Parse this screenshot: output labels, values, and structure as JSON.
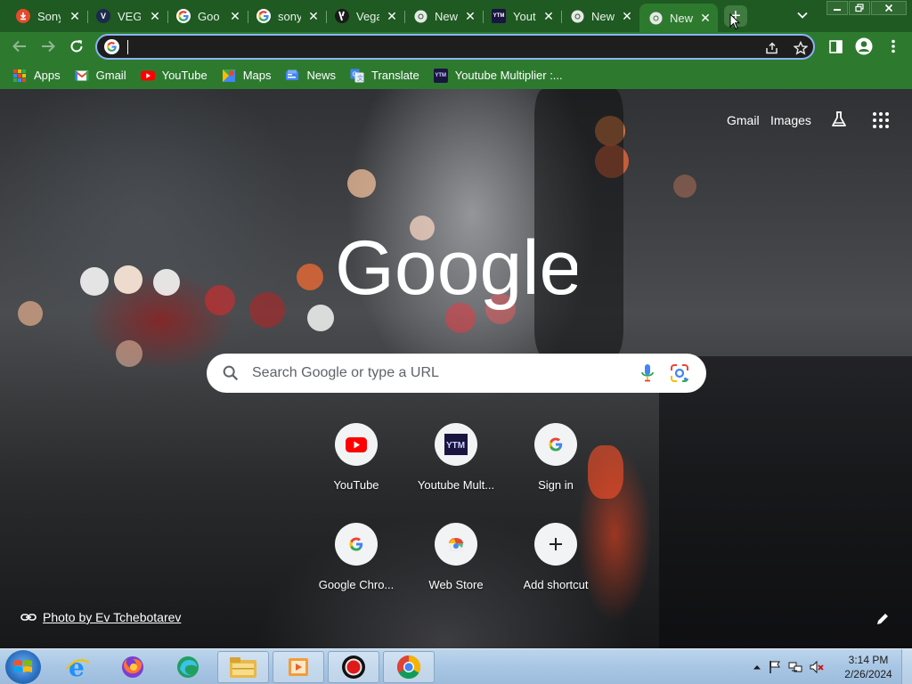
{
  "browser": {
    "tabs": [
      {
        "title": "Sony",
        "favicon": "sony-download-icon",
        "close": "✕"
      },
      {
        "title": "VEGA",
        "favicon": "vegas-v-icon",
        "close": "✕"
      },
      {
        "title": "Goo",
        "favicon": "google-g-icon",
        "close": "✕"
      },
      {
        "title": "sony",
        "favicon": "google-g-icon",
        "close": "✕"
      },
      {
        "title": "Vega",
        "favicon": "vegas-slash-icon",
        "close": "✕"
      },
      {
        "title": "New",
        "favicon": "chrome-icon",
        "close": "✕"
      },
      {
        "title": "Yout",
        "favicon": "ytm-icon",
        "close": "✕"
      },
      {
        "title": "New",
        "favicon": "chrome-icon",
        "close": "✕"
      },
      {
        "title": "New",
        "favicon": "chrome-icon",
        "close": "✕",
        "active": true
      }
    ],
    "new_tab_symbol": "+",
    "tabs_menu_symbol": "⌄",
    "omnibox": {
      "value": "",
      "placeholder": ""
    },
    "bookmarks": [
      {
        "label": "Apps",
        "icon": "apps-grid-icon"
      },
      {
        "label": "Gmail",
        "icon": "gmail-icon"
      },
      {
        "label": "YouTube",
        "icon": "youtube-icon"
      },
      {
        "label": "Maps",
        "icon": "maps-icon"
      },
      {
        "label": "News",
        "icon": "news-icon"
      },
      {
        "label": "Translate",
        "icon": "translate-icon"
      },
      {
        "label": "Youtube Multiplier :...",
        "icon": "ytm-icon"
      }
    ]
  },
  "ntp": {
    "gmail_link": "Gmail",
    "images_link": "Images",
    "search_placeholder": "Search Google or type a URL",
    "logo_text": "Google",
    "shortcuts": [
      {
        "label": "YouTube",
        "icon": "youtube-icon"
      },
      {
        "label": "Youtube Mult...",
        "icon": "ytm-icon"
      },
      {
        "label": "Sign in",
        "icon": "google-g-icon"
      },
      {
        "label": "Google Chro...",
        "icon": "google-g-icon"
      },
      {
        "label": "Web Store",
        "icon": "web-store-icon"
      },
      {
        "label": "Add shortcut",
        "icon": "plus-icon"
      }
    ],
    "attribution": "Photo by Ev Tchebotarev"
  },
  "taskbar": {
    "time": "3:14 PM",
    "date": "2/26/2024",
    "apps": [
      "internet-explorer-icon",
      "firefox-icon",
      "edge-icon",
      "file-explorer-icon",
      "media-player-icon",
      "record-icon",
      "chrome-icon"
    ]
  },
  "colors": {
    "tabstrip": "#1e5a22",
    "toolbar": "#2d7a2f",
    "omnibox_border": "#8ab4f8",
    "ytm_favicon": "#1a1440"
  }
}
